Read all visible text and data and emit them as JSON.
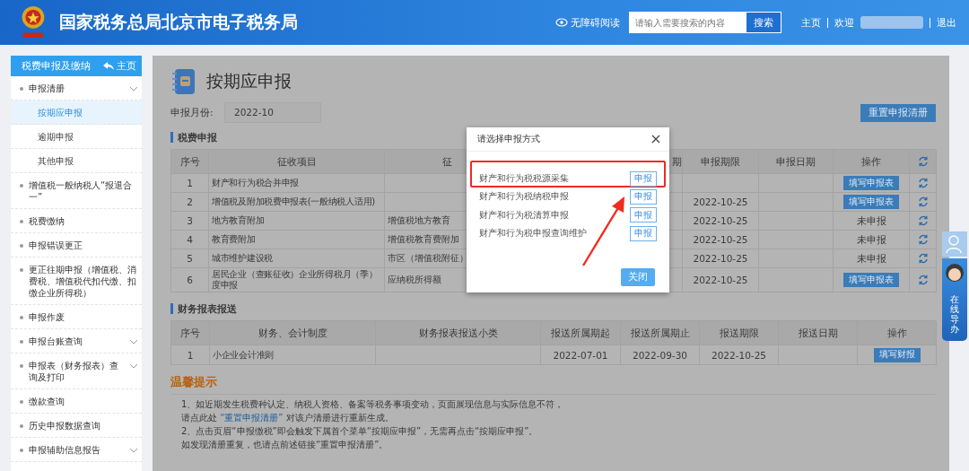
{
  "header": {
    "title": "国家税务总局北京市电子税务局",
    "accessibility": "无障碍阅读",
    "search": {
      "placeholder": "请输入需要搜索的内容",
      "button": "搜索"
    },
    "links": [
      "主页",
      "欢迎",
      "退出"
    ]
  },
  "sidebar": {
    "title": "税费申报及缴纳",
    "home": "主页",
    "items": [
      {
        "label": "申报清册",
        "has_menu": true,
        "selected": false,
        "children": [
          {
            "label": "按期应申报",
            "selected": true
          },
          {
            "label": "逾期申报",
            "selected": false
          },
          {
            "label": "其他申报",
            "selected": false
          }
        ]
      },
      {
        "label": "增值税一般纳税人“报退合一”",
        "has_menu": false,
        "selected": false
      },
      {
        "label": "税费缴纳",
        "has_menu": false,
        "selected": false
      },
      {
        "label": "申报错误更正",
        "has_menu": false,
        "selected": false
      },
      {
        "label": "更正往期申报（增值税、消费税、增值税代扣代缴、扣缴企业所得税）",
        "has_menu": false,
        "selected": false
      },
      {
        "label": "申报作废",
        "has_menu": false,
        "selected": false
      },
      {
        "label": "申报台账查询",
        "has_menu": true,
        "selected": false
      },
      {
        "label": "申报表（财务报表）查询及打印",
        "has_menu": true,
        "selected": false
      },
      {
        "label": "缴款查询",
        "has_menu": false,
        "selected": false
      },
      {
        "label": "历史申报数据查询",
        "has_menu": false,
        "selected": false
      },
      {
        "label": "申报辅助信息报告",
        "has_menu": true,
        "selected": false
      }
    ]
  },
  "main": {
    "title": "按期应申报",
    "month_label": "申报月份:",
    "month_value": "2022-10",
    "reset_button": "重置申报清册",
    "tax_section": {
      "title": "税费申报",
      "header": {
        "no": "序号",
        "item": "征收项目",
        "column_3": "征",
        "column_5": "期",
        "deadline": "申报期限",
        "date": "申报日期",
        "action": "操作"
      },
      "rows": [
        {
          "no": "1",
          "item": "财产和行为税合并申报",
          "action": {
            "kind": "button",
            "label": "填写申报表"
          }
        },
        {
          "no": "2",
          "item": "增值税及附加税费申报表(一般纳税人适用)",
          "deadline": "2022-10-25",
          "action": {
            "kind": "button",
            "label": "填写申报表"
          }
        },
        {
          "no": "3",
          "item": "地方教育附加",
          "column_3": "增值税地方教育",
          "deadline": "2022-10-25",
          "action": {
            "kind": "text",
            "label": "未申报"
          }
        },
        {
          "no": "4",
          "item": "教育费附加",
          "column_3": "增值税教育费附加",
          "deadline": "2022-10-25",
          "action": {
            "kind": "text",
            "label": "未申报"
          }
        },
        {
          "no": "5",
          "item": "城市维护建设税",
          "column_3": "市区（增值税附征）",
          "deadline": "2022-10-25",
          "action": {
            "kind": "text",
            "label": "未申报"
          }
        },
        {
          "no": "6",
          "item": "居民企业（查账征收）企业所得税月（季）度申报",
          "column_3": "应纳税所得额",
          "deadline": "2022-10-25",
          "action": {
            "kind": "button",
            "label": "填写申报表"
          }
        }
      ]
    },
    "finance_section": {
      "title": "财务报表报送",
      "header": {
        "no": "序号",
        "system": "财务、会计制度",
        "subtype": "财务报表报送小类",
        "start": "报送所属期起",
        "end": "报送所属期止",
        "deadline": "报送期限",
        "date": "报送日期",
        "action": "操作"
      },
      "rows": [
        {
          "no": "1",
          "system": "小企业会计准则",
          "start": "2022-07-01",
          "end": "2022-09-30",
          "deadline": "2022-10-25",
          "action": {
            "kind": "button",
            "label": "填写财报"
          }
        }
      ]
    },
    "tips": {
      "title": "温馨提示",
      "lines": [
        {
          "parts": [
            {
              "text": "1、如近期发生税费种认定、纳税人资格、备案等税务事项变动，页面展现信息与实际信息不符，",
              "link": false
            }
          ]
        },
        {
          "parts": [
            {
              "text": "请点此处 ",
              "link": false
            },
            {
              "text": "“重置申报清册”",
              "link": true
            },
            {
              "text": " 对该户清册进行重新生成。",
              "link": false
            }
          ]
        },
        {
          "parts": [
            {
              "text": "2、点击页眉“申报缴税”即会触发下属首个菜单“按期应申报”，无需再点击“按期应申报”。",
              "link": false
            }
          ]
        },
        {
          "parts": [
            {
              "text": "如发现清册重复，也请点前述链接“重置申报清册”。",
              "link": false
            }
          ]
        }
      ]
    }
  },
  "modal": {
    "title": "请选择申报方式",
    "options": [
      {
        "label": "财产和行为税税源采集",
        "button": "申报",
        "highlighted": true
      },
      {
        "label": "财产和行为税纳税申报",
        "button": "申报",
        "highlighted": false
      },
      {
        "label": "财产和行为税清算申报",
        "button": "申报",
        "highlighted": false
      },
      {
        "label": "财产和行为税申报查询维护",
        "button": "申报",
        "highlighted": false
      }
    ],
    "close_button": "关闭"
  },
  "guide": {
    "label": "在线导办"
  }
}
